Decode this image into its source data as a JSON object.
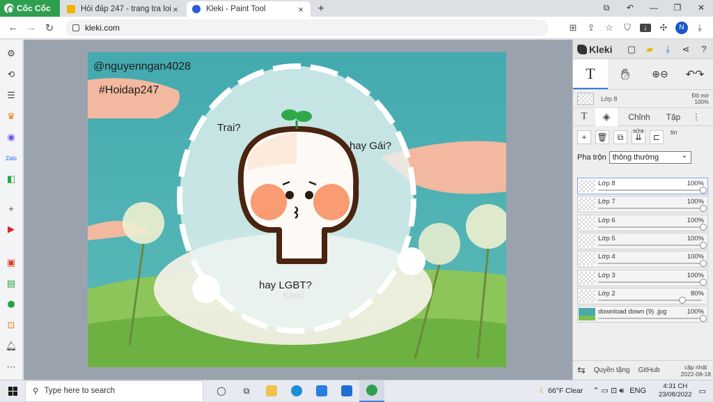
{
  "browser": {
    "brand": "Cốc Cốc",
    "tabs": [
      {
        "title": "Hỏi đáp 247 - trang tra loi",
        "active": false,
        "favicon_color": "#f0b400"
      },
      {
        "title": "Kleki - Paint Tool",
        "active": true,
        "favicon_color": "#2b5bd7"
      }
    ],
    "url": "kleki.com",
    "profile_initial": "N"
  },
  "artwork": {
    "watermark_user": "@nguyenngan4028",
    "hashtag": "#Hoidap247",
    "q1": "Trai?",
    "q2": "hay Gái?",
    "q3": "hay LGBT?",
    "faint_watermark": "Kleki"
  },
  "kleki": {
    "logo": "Kleki",
    "tool_text": "T",
    "current_layer": {
      "name": "Lớp 8",
      "opacity_label": "Độ mờ",
      "opacity": "100%"
    },
    "tabs": {
      "text": "T",
      "chinh": "Chỉnh",
      "tap": "Tập",
      "tin": "tin",
      "sua": "sửa"
    },
    "blend_label": "Pha trộn",
    "blend_value": "thông thường",
    "layers": [
      {
        "name": "Lớp 8",
        "opacity": "100%",
        "level": 1.0
      },
      {
        "name": "Lớp 7",
        "opacity": "100%",
        "level": 1.0
      },
      {
        "name": "Lớp 6",
        "opacity": "100%",
        "level": 1.0
      },
      {
        "name": "Lớp 5",
        "opacity": "100%",
        "level": 1.0
      },
      {
        "name": "Lớp 4",
        "opacity": "100%",
        "level": 1.0
      },
      {
        "name": "Lớp 3",
        "opacity": "100%",
        "level": 1.0
      },
      {
        "name": "Lớp 2",
        "opacity": "80%",
        "level": 0.8
      },
      {
        "name": "download down (9) .jpg",
        "opacity": "100%",
        "level": 1.0
      }
    ],
    "footer": {
      "privacy": "Quyền tặng",
      "github": "GitHub",
      "update_label": "cập nhật",
      "update_date": "2022-08-18"
    }
  },
  "taskbar": {
    "search_placeholder": "Type here to search",
    "weather": "66°F  Clear",
    "lang": "ENG",
    "time": "4:31 CH",
    "date": "23/08/2022"
  }
}
